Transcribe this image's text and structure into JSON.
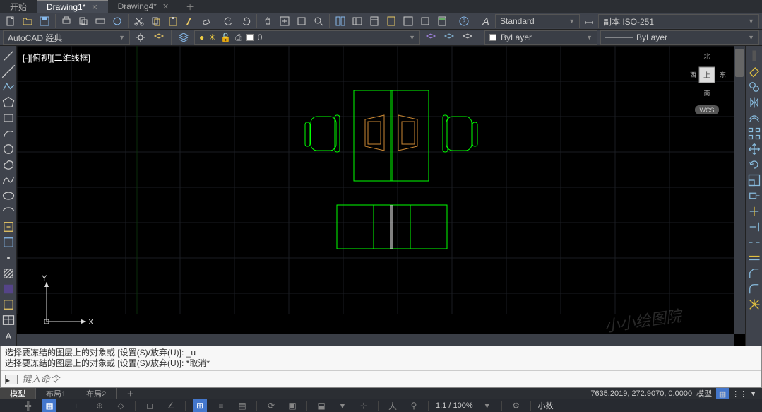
{
  "tabs": {
    "items": [
      {
        "label": "开始",
        "active": false,
        "closable": false
      },
      {
        "label": "Drawing1*",
        "active": true,
        "closable": true
      },
      {
        "label": "Drawing4*",
        "active": false,
        "closable": true
      }
    ]
  },
  "toolbar": {
    "style_combo": "Standard",
    "dim_combo": "副本 ISO-251"
  },
  "toolbar2": {
    "workspace": "AutoCAD 经典",
    "layer": "0",
    "linetype": "ByLayer",
    "linetype2": "ByLayer"
  },
  "viewport": {
    "label": "[-][俯视][二维线框]",
    "watermark": "小小绘图院",
    "cube": {
      "n": "北",
      "s": "南",
      "e": "东",
      "w": "西",
      "top": "上",
      "wcs": "WCS"
    }
  },
  "ucs": {
    "x": "X",
    "y": "Y"
  },
  "command": {
    "history": [
      "选择要冻结的图层上的对象或 [设置(S)/放弃(U)]: _u",
      "选择要冻结的图层上的对象或 [设置(S)/放弃(U)]: *取消*"
    ],
    "placeholder": "键入命令"
  },
  "layout": {
    "tabs": [
      "模型",
      "布局1",
      "布局2"
    ]
  },
  "status": {
    "coords": "7635.2019, 272.9070, 0.0000",
    "model": "模型"
  },
  "bottom": {
    "zoom": "1:1 / 100%",
    "decimal": "小数"
  }
}
